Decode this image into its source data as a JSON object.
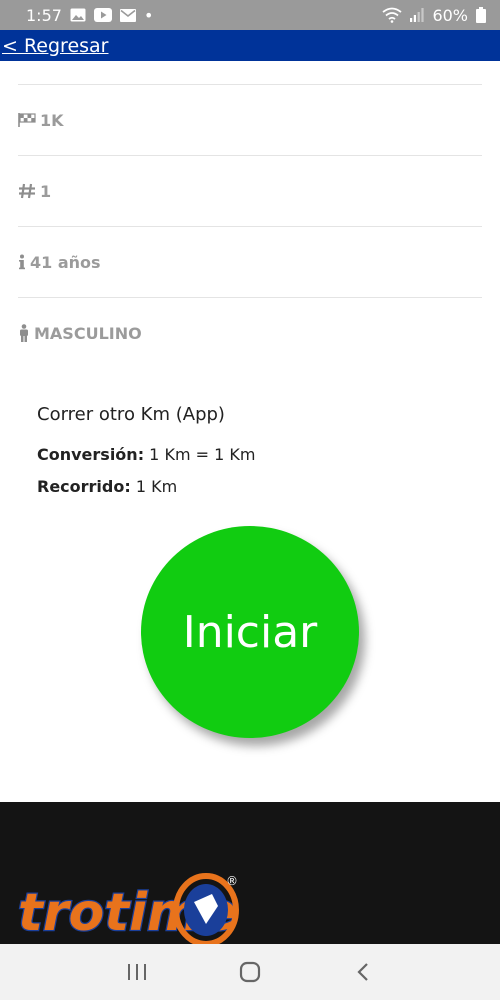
{
  "status_bar": {
    "time": "1:57",
    "dot": "•",
    "battery_percent": "60%",
    "icons": [
      "image-icon",
      "youtube-icon",
      "mail-icon",
      "wifi-icon",
      "signal-icon",
      "battery-icon"
    ]
  },
  "nav": {
    "back_label": "< Regresar"
  },
  "info": {
    "distance": "1K",
    "number": "1",
    "age": "41 años",
    "gender": "MASCULINO",
    "icons": [
      "flag-icon",
      "hash-icon",
      "info-icon",
      "person-icon"
    ]
  },
  "race": {
    "title": "Correr otro Km (App)",
    "conversion_label": "Conversión:",
    "conversion_value": " 1 Km = 1 Km",
    "route_label": "Recorrido:",
    "route_value": " 1 Km"
  },
  "start_button": {
    "label": "Iniciar",
    "color": "#11cc11"
  },
  "footer": {
    "logo_text": "trotime",
    "registered": "®"
  },
  "colors": {
    "nav": "#003399",
    "status_bar": "#9a9a9a",
    "footer": "#141414",
    "logo_orange": "#e8731c",
    "logo_blue": "#1a3f9a"
  }
}
